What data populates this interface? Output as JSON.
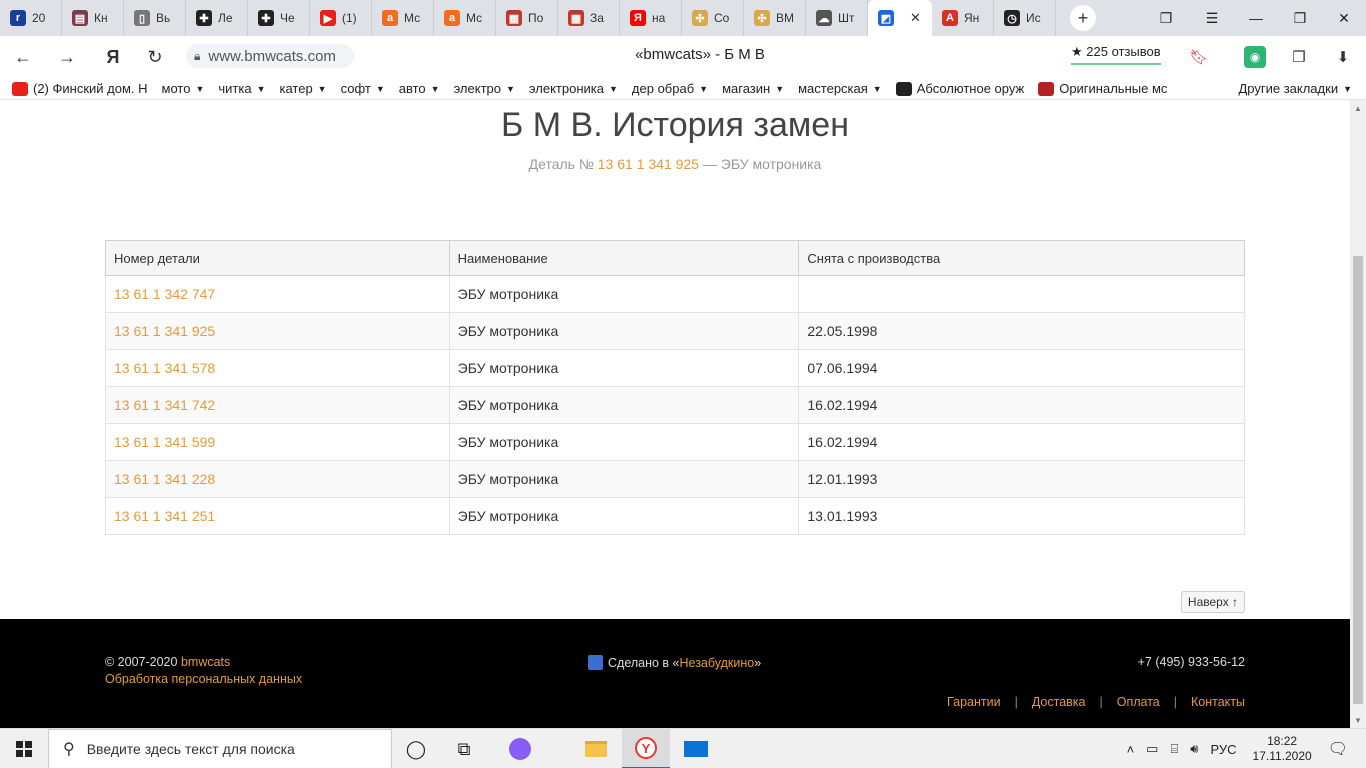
{
  "browser": {
    "tabs": [
      {
        "label": "20",
        "icon": "r-icon",
        "color": "#1a3e9a"
      },
      {
        "label": "Кн",
        "icon": "book-icon",
        "color": "#7a3b4c"
      },
      {
        "label": "Вь",
        "icon": "page-icon",
        "color": "#777777"
      },
      {
        "label": "Ле",
        "icon": "plus-square-icon",
        "color": "#222222"
      },
      {
        "label": "Че",
        "icon": "plus-square-icon",
        "color": "#222222"
      },
      {
        "label": "(1)",
        "icon": "youtube-icon",
        "color": "#e62117"
      },
      {
        "label": "Мс",
        "icon": "a-icon",
        "color": "#f26b21"
      },
      {
        "label": "Мс",
        "icon": "a-icon",
        "color": "#f26b21"
      },
      {
        "label": "По",
        "icon": "store-icon",
        "color": "#c0392b"
      },
      {
        "label": "За",
        "icon": "store-icon",
        "color": "#c0392b"
      },
      {
        "label": "на",
        "icon": "yandex-icon",
        "color": "#ff0000"
      },
      {
        "label": "Co",
        "icon": "gear-cross-icon",
        "color": "#d8a94a"
      },
      {
        "label": "BM",
        "icon": "gear-cross-icon",
        "color": "#d8a94a"
      },
      {
        "label": "Шт",
        "icon": "cloud-icon",
        "color": "#555555"
      },
      {
        "label": "",
        "icon": "bmw-icon",
        "color": "#1c69d4",
        "active": true
      },
      {
        "label": "Ян",
        "icon": "a-badge-icon",
        "color": "#d93025"
      },
      {
        "label": "Ис",
        "icon": "clock-icon",
        "color": "#222222"
      }
    ],
    "url": "www.bmwcats.com",
    "page_title": "«bmwcats» - Б М В",
    "reviews": "★ 225 отзывов",
    "bookmarks": [
      {
        "label": "(2) Финский дом. Н",
        "icon": "youtube-icon",
        "caret": false
      },
      {
        "label": "мото",
        "caret": true
      },
      {
        "label": "читка",
        "caret": true
      },
      {
        "label": "катер",
        "caret": true
      },
      {
        "label": "софт",
        "caret": true
      },
      {
        "label": "авто",
        "caret": true
      },
      {
        "label": "электро",
        "caret": true
      },
      {
        "label": "электроника",
        "caret": true
      },
      {
        "label": "дер обраб",
        "caret": true
      },
      {
        "label": "магазин",
        "caret": true
      },
      {
        "label": "мастерская",
        "caret": true
      },
      {
        "label": "Абсолютное оруж",
        "icon": "plus-square-icon",
        "caret": false
      },
      {
        "label": "Оригинальные мс",
        "icon": "atv-icon",
        "caret": false
      }
    ],
    "other_bookmarks": "Другие закладки"
  },
  "page": {
    "heading": "Б М В. История замен",
    "sub_prefix": "Деталь №",
    "sub_part": "13 61 1 341 925",
    "sub_suffix": "— ЭБУ мотроника",
    "table": {
      "headers": [
        "Номер детали",
        "Наименование",
        "Снята с производства"
      ],
      "rows": [
        {
          "part": "13 61 1 342 747",
          "name": "ЭБУ мотроника",
          "date": ""
        },
        {
          "part": "13 61 1 341 925",
          "name": "ЭБУ мотроника",
          "date": "22.05.1998"
        },
        {
          "part": "13 61 1 341 578",
          "name": "ЭБУ мотроника",
          "date": "07.06.1994"
        },
        {
          "part": "13 61 1 341 742",
          "name": "ЭБУ мотроника",
          "date": "16.02.1994"
        },
        {
          "part": "13 61 1 341 599",
          "name": "ЭБУ мотроника",
          "date": "16.02.1994"
        },
        {
          "part": "13 61 1 341 228",
          "name": "ЭБУ мотроника",
          "date": "12.01.1993"
        },
        {
          "part": "13 61 1 341 251",
          "name": "ЭБУ мотроника",
          "date": "13.01.1993"
        }
      ]
    },
    "to_top": "Наверх ↑"
  },
  "footer": {
    "copyright_prefix": "© 2007-2020",
    "copyright_link": "bmwcats",
    "privacy": "Обработка персональных данных",
    "madein_prefix": "Сделано в «",
    "madein_link": "Незабудкино",
    "madein_suffix": "»",
    "phone": "+7 (495) 933-56-12",
    "links": [
      "Гарантии",
      "Доставка",
      "Оплата",
      "Контакты"
    ]
  },
  "taskbar": {
    "search_placeholder": "Введите здесь текст для поиска",
    "lang": "РУС",
    "time": "18:22",
    "date": "17.11.2020"
  },
  "colors": {
    "accent": "#e69a3e",
    "footer_bg": "#000000"
  }
}
